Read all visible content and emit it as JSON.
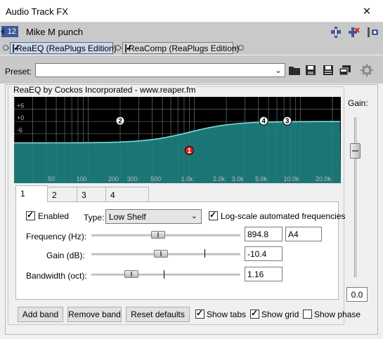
{
  "window": {
    "title": "Audio Track FX",
    "close_glyph": "✕"
  },
  "track": {
    "number": "12",
    "name": "Mike M punch",
    "icons": [
      "pin-icon",
      "bypass-icon",
      "settings-icon"
    ]
  },
  "fx_chain": [
    {
      "label": "ReaEQ (ReaPlugs Edition)",
      "enabled": true,
      "selected": true
    },
    {
      "label": "ReaComp (ReaPlugs Edition)",
      "enabled": true,
      "selected": false
    }
  ],
  "preset": {
    "label": "Preset:",
    "value": "",
    "icons": [
      "open-folder-icon",
      "save-icon",
      "save-as-icon",
      "copy-icon",
      "gear-icon"
    ]
  },
  "plugin": {
    "group_title": "ReaEQ by Cockos Incorporated - www.reaper.fm"
  },
  "eq_display": {
    "db_labels": [
      "+6",
      "+0",
      "-6"
    ],
    "freq_labels": [
      "50",
      "100",
      "200",
      "300",
      "500",
      "1.0k",
      "2.0k",
      "3.0k",
      "5.0k",
      "10.0k",
      "20.0k"
    ],
    "band_nodes": [
      {
        "id": "1",
        "freq": 894.8,
        "gain_db": -10.4,
        "selected": true
      },
      {
        "id": "2",
        "freq": 200,
        "gain_db": 0
      },
      {
        "id": "3",
        "freq": 7500,
        "gain_db": 0
      },
      {
        "id": "4",
        "freq": 4500,
        "gain_db": 0
      }
    ],
    "colors": {
      "fill": "#1e7b7b",
      "curve": "#7be0e0",
      "grid": "#5a5a5a",
      "selected_node": "#e02020"
    }
  },
  "tabs": [
    {
      "label": "1",
      "selected": true
    },
    {
      "label": "2",
      "selected": false
    },
    {
      "label": "3",
      "selected": false
    },
    {
      "label": "4",
      "selected": false
    }
  ],
  "band": {
    "enabled_label": "Enabled",
    "enabled": true,
    "type_label": "Type:",
    "type_value": "Low Shelf",
    "logscale_label": "Log-scale automated frequencies",
    "logscale": true,
    "frequency": {
      "label": "Frequency (Hz):",
      "value": "894.8",
      "note": "A4"
    },
    "gain": {
      "label": "Gain (dB):",
      "value": "-10.4"
    },
    "bandwidth": {
      "label": "Bandwidth (oct):",
      "value": "1.16"
    }
  },
  "buttons": {
    "add_band": "Add band",
    "remove_band": "Remove band",
    "reset_defaults": "Reset defaults"
  },
  "options": {
    "show_tabs": {
      "label": "Show tabs",
      "checked": true
    },
    "show_grid": {
      "label": "Show grid",
      "checked": true
    },
    "show_phase": {
      "label": "Show phase",
      "checked": false
    }
  },
  "gain_panel": {
    "label": "Gain:",
    "value": "0.0"
  }
}
